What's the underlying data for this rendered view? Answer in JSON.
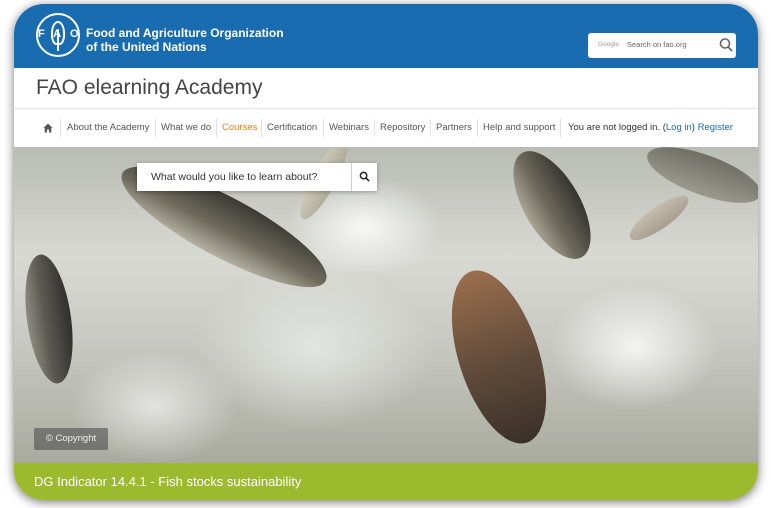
{
  "header": {
    "org_line1": "Food and Agriculture Organization",
    "org_line2": "of the United Nations",
    "logo_text": "FAO",
    "search_brand": "Google",
    "search_placeholder": "Search on fao.org"
  },
  "app": {
    "title": "FAO elearning Academy"
  },
  "nav": {
    "items": [
      {
        "label": "About the Academy"
      },
      {
        "label": "What we do"
      },
      {
        "label": "Courses",
        "active": true
      },
      {
        "label": "Certification"
      },
      {
        "label": "Webinars"
      },
      {
        "label": "Repository"
      },
      {
        "label": "Partners"
      },
      {
        "label": "Help and support"
      }
    ],
    "login_prefix": "You are not logged in. (",
    "login_link": "Log in",
    "login_suffix": ") ",
    "register_link": "Register"
  },
  "hero": {
    "search_prompt": "What would you like to learn about?",
    "copyright": "© Copyright"
  },
  "banner": {
    "text": "DG Indicator 14.4.1 - Fish stocks sustainability"
  },
  "colors": {
    "header_blue": "#1a6cb1",
    "active_nav": "#e8801e",
    "banner_green": "#9bba2e"
  },
  "icons": {
    "home": "home-icon",
    "search": "search-icon",
    "logo": "fao-logo-icon"
  }
}
